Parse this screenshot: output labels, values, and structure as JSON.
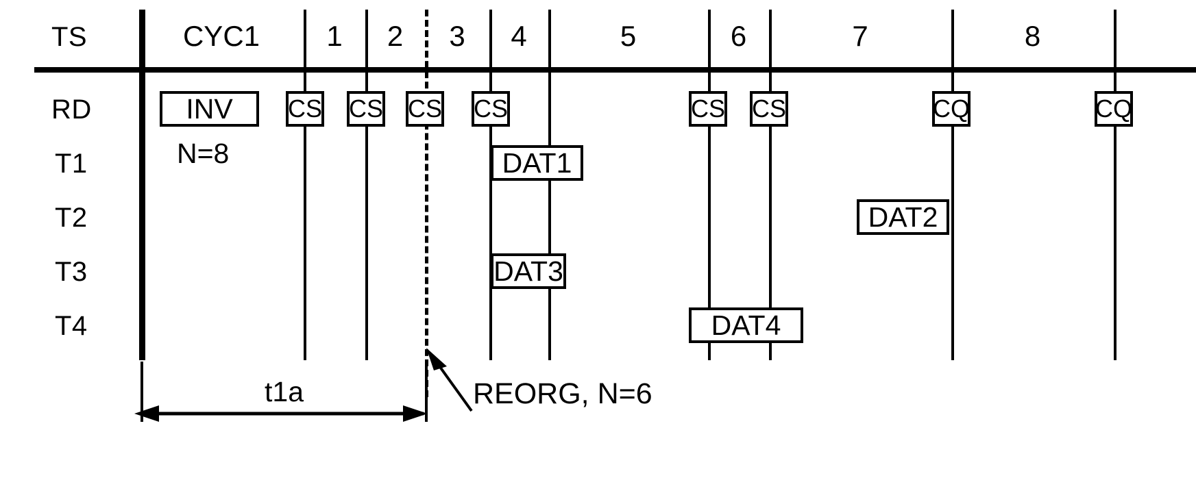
{
  "figure": {
    "type": "timing-diagram",
    "corner_label": "TS",
    "row_labels": [
      "RD",
      "T1",
      "T2",
      "T3",
      "T4"
    ],
    "column_headers": [
      {
        "label": "CYC1"
      },
      {
        "label": "1"
      },
      {
        "label": "2"
      },
      {
        "label": "3"
      },
      {
        "label": "4"
      },
      {
        "label": "5"
      },
      {
        "label": "6"
      },
      {
        "label": "7"
      },
      {
        "label": "8"
      }
    ],
    "rd_boxes": [
      {
        "label": "INV"
      },
      {
        "label": "CS"
      },
      {
        "label": "CS"
      },
      {
        "label": "CS"
      },
      {
        "label": "CS"
      },
      {
        "label": "CS"
      },
      {
        "label": "CS"
      },
      {
        "label": "CQ"
      },
      {
        "label": "CQ"
      }
    ],
    "inv_count_label": "N=8",
    "data_boxes": [
      {
        "label": "DAT1",
        "row": "T1"
      },
      {
        "label": "DAT2",
        "row": "T2"
      },
      {
        "label": "DAT3",
        "row": "T3"
      },
      {
        "label": "DAT4",
        "row": "T4"
      }
    ],
    "annotations": {
      "reorg": "REORG, N=6",
      "duration": "t1a"
    },
    "colors": {
      "ink": "#000000",
      "background": "#ffffff"
    }
  }
}
